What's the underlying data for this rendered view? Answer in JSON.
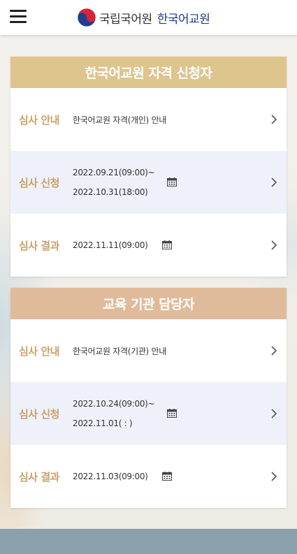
{
  "header": {
    "org_name": "국립국어원",
    "service_name": "한국어교원",
    "menu_icon": "hamburger-menu-icon",
    "logo_icon": "taegeuk-emblem-icon"
  },
  "sections": [
    {
      "title": "한국어교원 자격 신청자",
      "rows": [
        {
          "label": "심사 안내",
          "text": "한국어교원 자격(개인) 안내"
        },
        {
          "label": "심사 신청",
          "date_start": "2022.09.21(09:00)~",
          "date_end": "2022.10.31(18:00)"
        },
        {
          "label": "심사 결과",
          "date": "2022.11.11(09:00)"
        }
      ]
    },
    {
      "title": "교육 기관 담당자",
      "rows": [
        {
          "label": "심사 안내",
          "text": "한국어교원 자격(기관) 안내"
        },
        {
          "label": "심사 신청",
          "date_start": "2022.10.24(09:00)~",
          "date_end": "2022.11.01( : )"
        },
        {
          "label": "심사 결과",
          "date": "2022.11.03(09:00)"
        }
      ]
    }
  ],
  "colors": {
    "section1_header": "#dec48d",
    "section2_header": "#e0bb9b",
    "label_gold": "#c9a26a",
    "alt_row": "#eef1f9",
    "footer": "#8aa1ac"
  }
}
